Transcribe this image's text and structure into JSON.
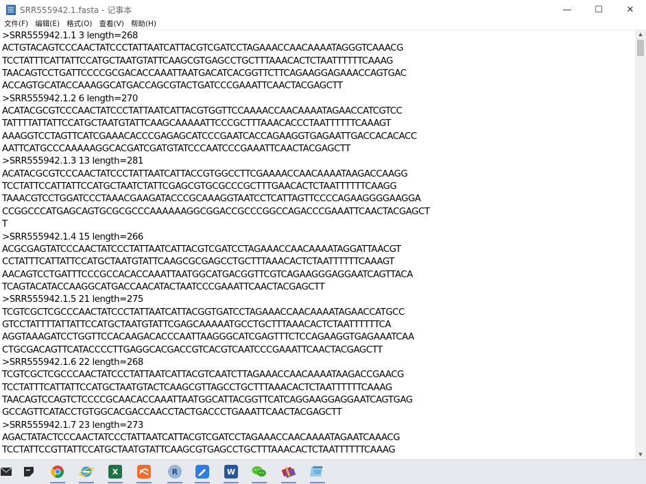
{
  "window": {
    "title": "SRR555942.1.fasta - 记事本",
    "minimize_label": "—",
    "maximize_label": "☐",
    "close_label": "✕"
  },
  "menu": [
    {
      "label": "文件(F)"
    },
    {
      "label": "编辑(E)"
    },
    {
      "label": "格式(O)"
    },
    {
      "label": "查看(V)"
    },
    {
      "label": "帮助(H)"
    }
  ],
  "editor": {
    "lines": [
      ">SRR555942.1.1 3 length=268",
      "ACTGTACAGTCCCAACTATCCCTATTAATCATTACGTCGATCCTAGAAACCAACAAAATAGGGTCAAACG",
      "TCCTATTTCATTATTCCATGCTAATGTATTCAAGCGTGAGCCTGCTTTAAACACTCTAATTTTTTCAAAG",
      "TAACAGTCCTGATTCCCCGCGACACCAAATTAATGACATCACGGTTCTTCAGAAGGAGAAACCAGTGAC",
      "ACCAGTGCATACCAAAGGCATGACCAGCGTACTGATCCCGAAATTCAACTACGAGCTT",
      ">SRR555942.1.2 6 length=270",
      "ACATACGCGTCCCAACTATCCCTATTAATCATTACGTGGTTCCAAAACCAACAAAATAGAACCATCGTCC",
      "TATTTTATTATTCCATGCTAATGTATTCAAGCAAAAATTCCCGCTTTAAACACCCTAATTTTTTCAAAGT",
      "AAAGGTCCTAGTTCATCGAAACACCCGAGAGCATCCCGAATCACCAGAAGGTGAGAATTGACCACACACC",
      "AATTCATGCCCAAAAAGGCACGATCGATGTATCCCAATCCCGAAATTCAACTACGAGCTT",
      ">SRR555942.1.3 13 length=281",
      "ACATACGCGTCCCAACTATCCCTATTAATCATTACCGTGGCCTTCGAAAACCAACAAAATAAGACCAAGG",
      "TCCTATTCCATTATTCCATGCTAATCTATTCGAGCGTGCGCCCGCTTTGAACACTCTAATTTTTTCAAGG",
      "TAAACGTCCTGGATCCCTAAACGAAGATACCCGCAAAGGTAATCCTCATTAGTTCCCCAGAAGGGGAAGGA",
      "CCGGCCCATGAGCAGTGCGCGCCCAAAAAAGGCGGACCGCCCGGCCAGACCCGAAATTCAACTACGAGCT",
      "T",
      ">SRR555942.1.4 15 length=266",
      "ACGCGAGTATCCCAACTATCCCTATTAATCATTACGTCGATCCTAGAAACCAACAAAATAGGATTAACGT",
      "CCTATTTCATTATTCCATGCTAATGTATTCAAGCGCGAGCCTGCTTTAAACACTCTAATTTTTTCAAAGT",
      "AACAGTCCTGATTTCCCGCCACACCAAATTAATGGCATGACGGTTCGTCAGAAGGGAGGAATCAGTTACA",
      "TCAGTACATACCAAGGCATGACCAACATACTAATCCCGAAATTCAACTACGAGCTT",
      ">SRR555942.1.5 21 length=275",
      "TCGTCGCTCGCCCAACTATCCCTATTAATCATTACGGTGATCCTAGAAACCAACAAAATAGAACCATGCC",
      "GTCCTATTTTATTATTCCATGCTAATGTATTCGAGCAAAAATGCCTGCTTTAAACACTCTAATTTTTTCA",
      "AGGTAAAGATCCTGGTTCCACAAGACACCCAATTAAGGGCATCGAGTTTCTCCAGAAGGTGAGAAATCAA",
      "CTGCGACAGTTCATACCCCTTGAGGCACGACCGTCACGTCAATCCCGAAATTCAACTACGAGCTT",
      ">SRR555942.1.6 22 length=268",
      "TCGTCGCTCGCCCAACTATCCCTATTAATCATTACGTCAATCTTAGAAACCAACAAAATAAGACCGAACG",
      "TCCTATTTCATTATTCCATGCTAATGTACTCAAGCGTTAGCCTGCTTTAAACACTCTAATTTTTTCAAAG",
      "TAACAGTCCAGTCTCCCCGCAACACCAAATTAATGGCATTACGGTTCATCAGGAAGGAGGAATCAGTGAG",
      "GCCAGTTCATACCTGTGGCACGACCAACCTACTGACCCTGAAATTCAACTACGAGCTT",
      ">SRR555942.1.7 23 length=273",
      "AGACTATACTCCCAACTATCCCTATTAATCATTACGTCGATCCTAGAAACCAACAAAATAGAATCAAACG",
      "TCCTATTCCGTTATTCCATGCTAATGTATTCAAGCGTGAGCCTGCTTTAAACACTCTAATTTTTTCAAAG"
    ]
  },
  "taskbar": {
    "icons": [
      {
        "name": "mail-icon"
      },
      {
        "name": "sticky-notes-icon"
      },
      {
        "name": "chrome-icon"
      },
      {
        "name": "internet-explorer-icon"
      },
      {
        "name": "excel-icon",
        "glyph": "X"
      },
      {
        "name": "wps-icon"
      },
      {
        "name": "r-icon",
        "glyph": "R"
      },
      {
        "name": "pen-tool-icon"
      },
      {
        "name": "word-icon",
        "glyph": "W"
      },
      {
        "name": "wechat-icon"
      },
      {
        "name": "rar-archive-icon"
      },
      {
        "name": "notepad-icon"
      }
    ]
  }
}
